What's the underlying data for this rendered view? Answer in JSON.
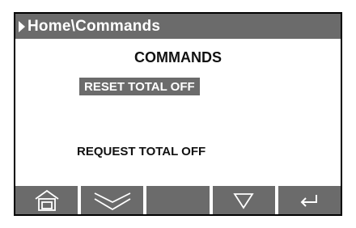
{
  "header": {
    "breadcrumb": "Home\\Commands"
  },
  "main": {
    "heading": "COMMANDS",
    "items": [
      {
        "label": "RESET TOTAL OFF",
        "selected": true
      },
      {
        "label": "REQUEST TOTAL OFF",
        "selected": false
      }
    ]
  },
  "softkeys": [
    {
      "icon": "home-icon"
    },
    {
      "icon": "double-chevron-down-icon"
    },
    {
      "icon": "blank"
    },
    {
      "icon": "down-triangle-icon"
    },
    {
      "icon": "enter-icon"
    }
  ],
  "colors": {
    "bar": "#6b6b6b",
    "text": "#111111",
    "background": "#ffffff"
  }
}
